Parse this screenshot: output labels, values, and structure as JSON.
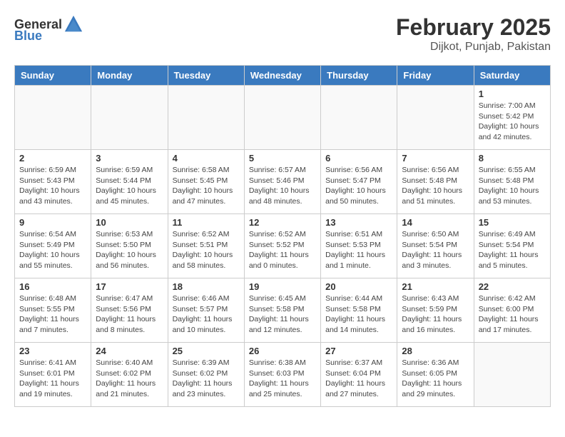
{
  "header": {
    "logo_general": "General",
    "logo_blue": "Blue",
    "main_title": "February 2025",
    "subtitle": "Dijkot, Punjab, Pakistan"
  },
  "days_of_week": [
    "Sunday",
    "Monday",
    "Tuesday",
    "Wednesday",
    "Thursday",
    "Friday",
    "Saturday"
  ],
  "weeks": [
    [
      {
        "day": "",
        "info": ""
      },
      {
        "day": "",
        "info": ""
      },
      {
        "day": "",
        "info": ""
      },
      {
        "day": "",
        "info": ""
      },
      {
        "day": "",
        "info": ""
      },
      {
        "day": "",
        "info": ""
      },
      {
        "day": "1",
        "info": "Sunrise: 7:00 AM\nSunset: 5:42 PM\nDaylight: 10 hours and 42 minutes."
      }
    ],
    [
      {
        "day": "2",
        "info": "Sunrise: 6:59 AM\nSunset: 5:43 PM\nDaylight: 10 hours and 43 minutes."
      },
      {
        "day": "3",
        "info": "Sunrise: 6:59 AM\nSunset: 5:44 PM\nDaylight: 10 hours and 45 minutes."
      },
      {
        "day": "4",
        "info": "Sunrise: 6:58 AM\nSunset: 5:45 PM\nDaylight: 10 hours and 47 minutes."
      },
      {
        "day": "5",
        "info": "Sunrise: 6:57 AM\nSunset: 5:46 PM\nDaylight: 10 hours and 48 minutes."
      },
      {
        "day": "6",
        "info": "Sunrise: 6:56 AM\nSunset: 5:47 PM\nDaylight: 10 hours and 50 minutes."
      },
      {
        "day": "7",
        "info": "Sunrise: 6:56 AM\nSunset: 5:48 PM\nDaylight: 10 hours and 51 minutes."
      },
      {
        "day": "8",
        "info": "Sunrise: 6:55 AM\nSunset: 5:48 PM\nDaylight: 10 hours and 53 minutes."
      }
    ],
    [
      {
        "day": "9",
        "info": "Sunrise: 6:54 AM\nSunset: 5:49 PM\nDaylight: 10 hours and 55 minutes."
      },
      {
        "day": "10",
        "info": "Sunrise: 6:53 AM\nSunset: 5:50 PM\nDaylight: 10 hours and 56 minutes."
      },
      {
        "day": "11",
        "info": "Sunrise: 6:52 AM\nSunset: 5:51 PM\nDaylight: 10 hours and 58 minutes."
      },
      {
        "day": "12",
        "info": "Sunrise: 6:52 AM\nSunset: 5:52 PM\nDaylight: 11 hours and 0 minutes."
      },
      {
        "day": "13",
        "info": "Sunrise: 6:51 AM\nSunset: 5:53 PM\nDaylight: 11 hours and 1 minute."
      },
      {
        "day": "14",
        "info": "Sunrise: 6:50 AM\nSunset: 5:54 PM\nDaylight: 11 hours and 3 minutes."
      },
      {
        "day": "15",
        "info": "Sunrise: 6:49 AM\nSunset: 5:54 PM\nDaylight: 11 hours and 5 minutes."
      }
    ],
    [
      {
        "day": "16",
        "info": "Sunrise: 6:48 AM\nSunset: 5:55 PM\nDaylight: 11 hours and 7 minutes."
      },
      {
        "day": "17",
        "info": "Sunrise: 6:47 AM\nSunset: 5:56 PM\nDaylight: 11 hours and 8 minutes."
      },
      {
        "day": "18",
        "info": "Sunrise: 6:46 AM\nSunset: 5:57 PM\nDaylight: 11 hours and 10 minutes."
      },
      {
        "day": "19",
        "info": "Sunrise: 6:45 AM\nSunset: 5:58 PM\nDaylight: 11 hours and 12 minutes."
      },
      {
        "day": "20",
        "info": "Sunrise: 6:44 AM\nSunset: 5:58 PM\nDaylight: 11 hours and 14 minutes."
      },
      {
        "day": "21",
        "info": "Sunrise: 6:43 AM\nSunset: 5:59 PM\nDaylight: 11 hours and 16 minutes."
      },
      {
        "day": "22",
        "info": "Sunrise: 6:42 AM\nSunset: 6:00 PM\nDaylight: 11 hours and 17 minutes."
      }
    ],
    [
      {
        "day": "23",
        "info": "Sunrise: 6:41 AM\nSunset: 6:01 PM\nDaylight: 11 hours and 19 minutes."
      },
      {
        "day": "24",
        "info": "Sunrise: 6:40 AM\nSunset: 6:02 PM\nDaylight: 11 hours and 21 minutes."
      },
      {
        "day": "25",
        "info": "Sunrise: 6:39 AM\nSunset: 6:02 PM\nDaylight: 11 hours and 23 minutes."
      },
      {
        "day": "26",
        "info": "Sunrise: 6:38 AM\nSunset: 6:03 PM\nDaylight: 11 hours and 25 minutes."
      },
      {
        "day": "27",
        "info": "Sunrise: 6:37 AM\nSunset: 6:04 PM\nDaylight: 11 hours and 27 minutes."
      },
      {
        "day": "28",
        "info": "Sunrise: 6:36 AM\nSunset: 6:05 PM\nDaylight: 11 hours and 29 minutes."
      },
      {
        "day": "",
        "info": ""
      }
    ]
  ]
}
